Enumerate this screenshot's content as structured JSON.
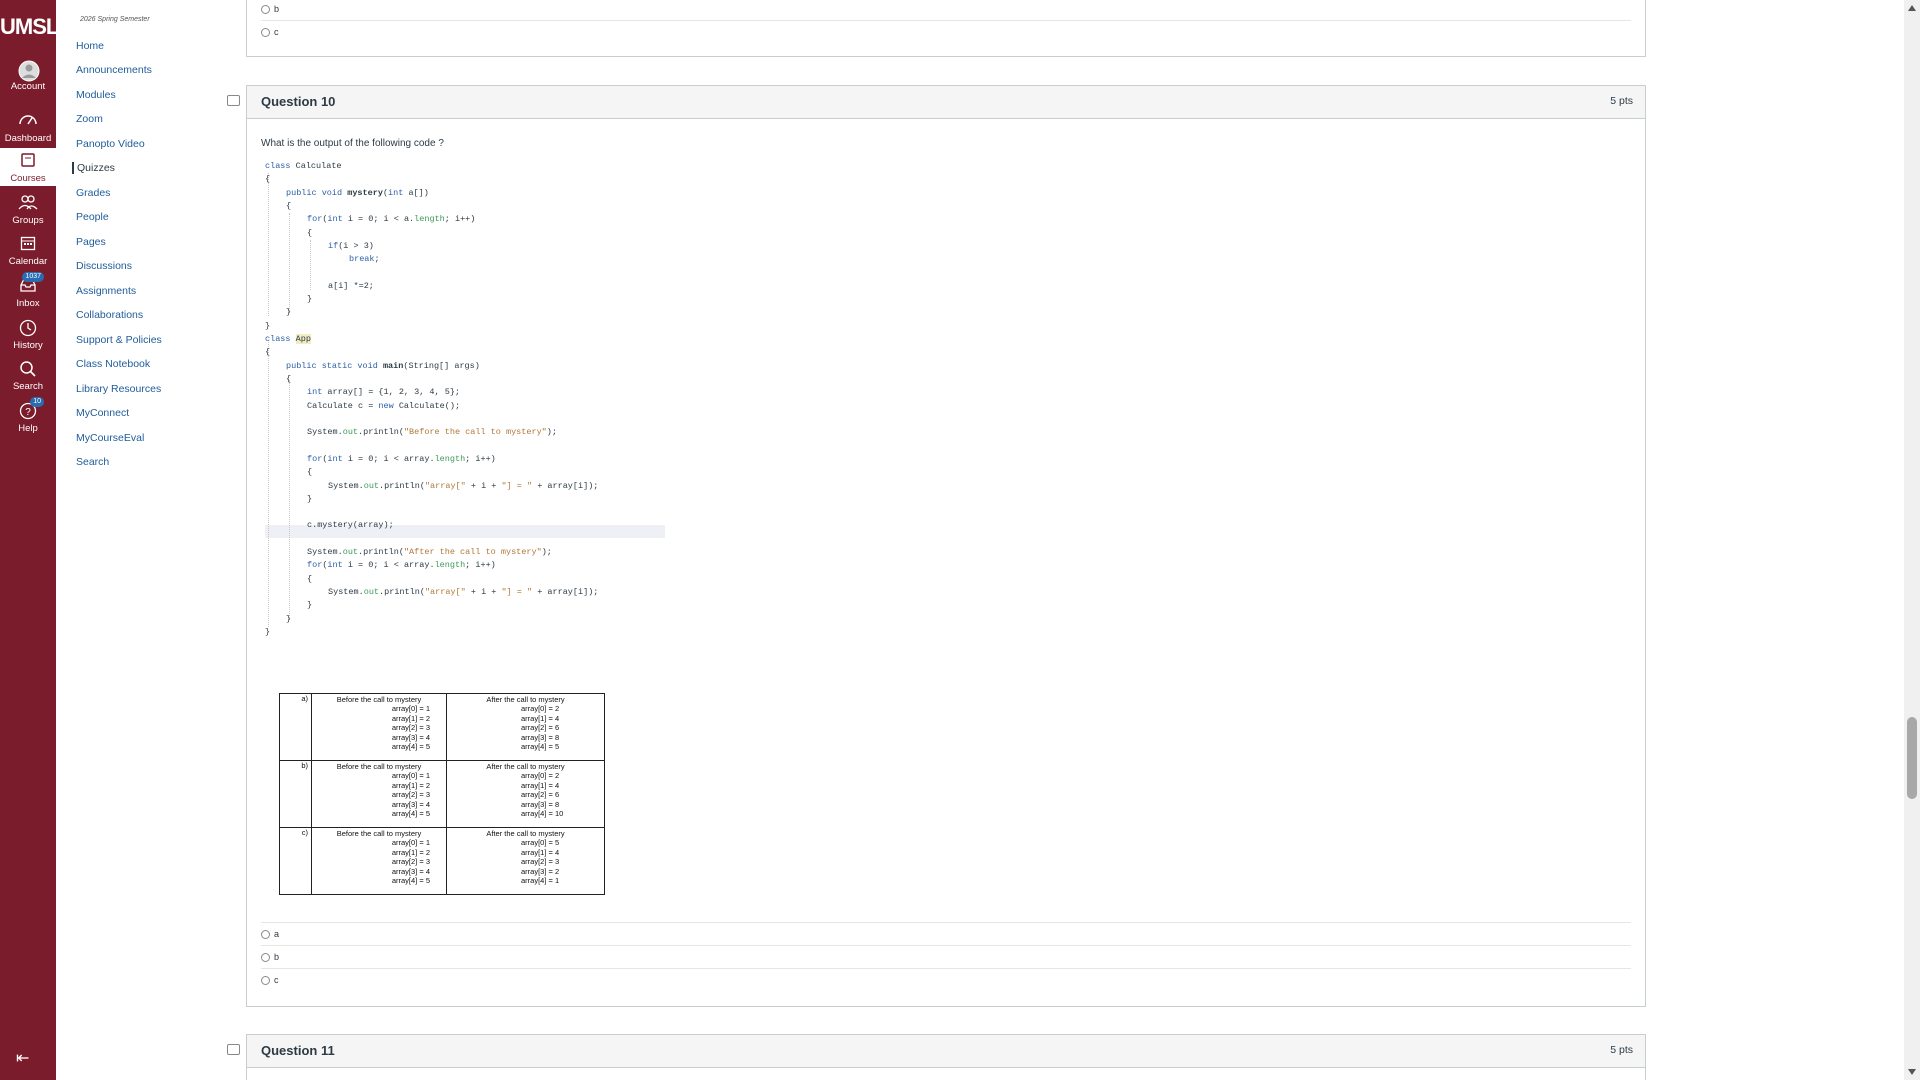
{
  "global_nav": {
    "logo": "UMSL",
    "items": [
      {
        "label": "Account",
        "icon": "account-icon"
      },
      {
        "label": "Dashboard",
        "icon": "dashboard-icon"
      },
      {
        "label": "Courses",
        "icon": "courses-icon"
      },
      {
        "label": "Groups",
        "icon": "groups-icon"
      },
      {
        "label": "Calendar",
        "icon": "calendar-icon"
      },
      {
        "label": "Inbox",
        "icon": "inbox-icon",
        "badge": "1037"
      },
      {
        "label": "History",
        "icon": "history-icon"
      },
      {
        "label": "Search",
        "icon": "search-icon"
      },
      {
        "label": "Help",
        "icon": "help-icon",
        "badge": "10"
      }
    ],
    "collapse": "⇤"
  },
  "course_nav": {
    "term": "2026 Spring Semester",
    "items": [
      "Home",
      "Announcements",
      "Modules",
      "Zoom",
      "Panopto Video",
      "Quizzes",
      "Grades",
      "People",
      "Pages",
      "Discussions",
      "Assignments",
      "Collaborations",
      "Support & Policies",
      "Class Notebook",
      "Library Resources",
      "MyConnect",
      "MyCourseEval",
      "Search"
    ],
    "active": "Quizzes"
  },
  "prev_question": {
    "answers": [
      "b",
      "c"
    ]
  },
  "question10": {
    "title": "Question 10",
    "points": "5 pts",
    "text": "What is the output of the following code ?",
    "code": [
      "class Calculate",
      "{",
      "    public void mystery(int a[])",
      "    {",
      "        for(int i = 0; i < a.length; i++)",
      "        {",
      "            if(i > 3)",
      "                break;",
      "",
      "            a[i] *=2;",
      "        }",
      "    }",
      "}",
      "class App",
      "{",
      "    public static void main(String[] args)",
      "    {",
      "        int array[] = {1, 2, 3, 4, 5};",
      "        Calculate c = new Calculate();",
      "",
      "        System.out.println(\"Before the call to mystery\");",
      "",
      "        for(int i = 0; i < array.length; i++)",
      "        {",
      "            System.out.println(\"array[\" + i + \"] = \" + array[i]);",
      "        }",
      "",
      "        c.mystery(array);",
      "",
      "        System.out.println(\"After the call to mystery\");",
      "        for(int i = 0; i < array.length; i++)",
      "        {",
      "            System.out.println(\"array[\" + i + \"] = \" + array[i]);",
      "        }",
      "    }",
      "}"
    ],
    "options_table": [
      {
        "letter": "a)",
        "before_title": "Before the call to mystery",
        "before": [
          "array[0] = 1",
          "array[1] = 2",
          "array[2] = 3",
          "array[3] = 4",
          "array[4] = 5"
        ],
        "after_title": "After the call to mystery",
        "after": [
          "array[0] = 2",
          "array[1] = 4",
          "array[2] = 6",
          "array[3] = 8",
          "array[4] = 5"
        ]
      },
      {
        "letter": "b)",
        "before_title": "Before the call to mystery",
        "before": [
          "array[0] = 1",
          "array[1] = 2",
          "array[2] = 3",
          "array[3] = 4",
          "array[4] = 5"
        ],
        "after_title": "After the call to mystery",
        "after": [
          "array[0] = 2",
          "array[1] = 4",
          "array[2] = 6",
          "array[3] = 8",
          "array[4] = 10"
        ]
      },
      {
        "letter": "c)",
        "before_title": "Before the call to mystery",
        "before": [
          "array[0] = 1",
          "array[1] = 2",
          "array[2] = 3",
          "array[3] = 4",
          "array[4] = 5"
        ],
        "after_title": "After the call to mystery",
        "after": [
          "array[0] = 5",
          "array[1] = 4",
          "array[2] = 3",
          "array[3] = 2",
          "array[4] = 1"
        ]
      }
    ],
    "answers": [
      "a",
      "b",
      "c"
    ]
  },
  "question11": {
    "title": "Question 11",
    "points": "5 pts"
  }
}
